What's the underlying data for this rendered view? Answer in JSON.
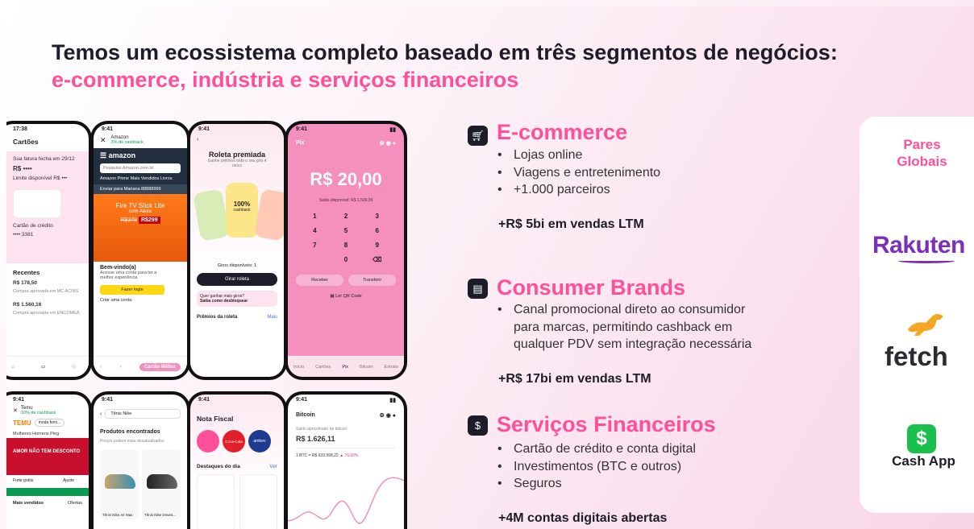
{
  "title": {
    "line1": "Temos um ecossistema completo baseado em três segmentos de negócios:",
    "line2": "e-commerce, indústria e serviços financeiros"
  },
  "sections": {
    "ecommerce": {
      "icon": "shopping-cart-icon",
      "title": "E-commerce",
      "bullets": [
        "Lojas online",
        "Viagens e entretenimento",
        "+1.000 parceiros"
      ],
      "stat": "+R$ 5bi em vendas LTM"
    },
    "brands": {
      "icon": "storefront-icon",
      "title": "Consumer Brands",
      "bullets": [
        "Canal promocional direto ao consumidor",
        "para marcas, permitindo cashback em",
        "qualquer PDV sem integração necessária"
      ],
      "stat": "+R$ 17bi em vendas LTM"
    },
    "finance": {
      "icon": "money-bag-icon",
      "title": "Serviços Financeiros",
      "bullets": [
        "Cartão de crédito e conta digital",
        "Investimentos (BTC e outros)",
        "Seguros"
      ],
      "stat": "+4M contas digitais abertas"
    },
    "bullet_char": "•"
  },
  "partners": {
    "title_line1": "Pares",
    "title_line2": "Globais",
    "rakuten": "Rakuten",
    "fetch": "fetch",
    "cashapp_icon": "$",
    "cashapp": "Cash App"
  },
  "phones": {
    "cards": {
      "time": "17:38",
      "title": "Cartões",
      "due": "Sua fatura fecha em 29/12",
      "amount": "R$ ••••",
      "limit": "Limite disponível R$ •••",
      "card_label": "Cartão de crédito",
      "card_num": "•••• 3381",
      "recent": "Recentes",
      "tx1": "R$ 178,50",
      "tx1_desc": "Compra aprovada em MC ACNIS",
      "tx2": "R$ 1.560,16",
      "tx2_desc": "Compra aprovada em ENCOMEA"
    },
    "amazon": {
      "time": "9:41",
      "store": "Amazon",
      "cashback": "3% de cashback",
      "logo": "amazon",
      "search": "Pesquise Amazon.com.br",
      "tabs": "Amazon Prime  Mais Vendidos  Livros",
      "deliver": "Enviar para Mariana 88888999",
      "promo": "Fire TV Stick Lite",
      "promo_sub": "com Alexa",
      "price_old": "R$349",
      "price": "R$299",
      "welcome": "Bem-vindo(a)",
      "welcome_sub": "Acesse uma conta para ter a melhor experiência",
      "login": "Fazer login",
      "create": "Criar uma conta",
      "button": "Cartão Méliuz"
    },
    "roleta": {
      "time": "9:41",
      "title": "Roleta premiada",
      "sub": "Ganhe prêmios todo o seu giro é único",
      "pct": "100%",
      "pct_sub": "cashback",
      "spins": "Giros disponíveis: 1",
      "btn": "Girar roleta",
      "tip": "Quer ganhar mais giros?",
      "tip_link": "Saiba como desbloquear",
      "prizes": "Prêmios da roleta",
      "more": "Mais"
    },
    "pix": {
      "time": "9:41",
      "title": "Pix",
      "amount": "R$ 20,00",
      "balance": "Saldo disponível: R$ 1.509,09",
      "keys": [
        "1",
        "2",
        "3",
        "4",
        "5",
        "6",
        "7",
        "8",
        "9",
        "",
        "0",
        "⌫"
      ],
      "receive": "Receber",
      "transfer": "Transferir",
      "qr": "Ler QR Code",
      "tabs": [
        "Início",
        "Cartões",
        "Pix",
        "Bitcoin",
        "Extrato"
      ]
    },
    "temu": {
      "time": "9:41",
      "store": "Temu",
      "cashback": "10% de cashback",
      "logo": "TEMU",
      "search": "moda femi...",
      "tabs": "Mulheres  Homens  Pleg",
      "banner": "AMOR NÃO TEM DESCONTO",
      "ship": "Frete grátis",
      "help": "Ajuste",
      "more": "Mais vendidos",
      "offers": "Ofertas"
    },
    "nike": {
      "time": "9:41",
      "search": "Tênis Nike",
      "found": "Produtos encontrados",
      "found_sub": "Preços podem estar desatualizados",
      "p1": "Tênis Nike Air Max",
      "p2": "Tênis Nike Downt..."
    },
    "nota": {
      "time": "9:41",
      "title": "Nota Fiscal",
      "b1": "Coca-Cola",
      "b2": "ambev",
      "highlights": "Destaques do dia",
      "more": "Ver"
    },
    "bitcoin": {
      "time": "9:41",
      "title": "Bitcoin",
      "balance_label": "Saldo aproximado de bitcoin",
      "balance": "R$ 1.626,11",
      "rate": "1 BTC = R$ 633.998,22",
      "change": "▲ 76.00%"
    }
  },
  "colors": {
    "pink": "#ff4f9a",
    "dark": "#1c1c2b",
    "purple": "#7c2fb8",
    "green": "#19c04b",
    "pix_pink": "#f48fbe"
  }
}
